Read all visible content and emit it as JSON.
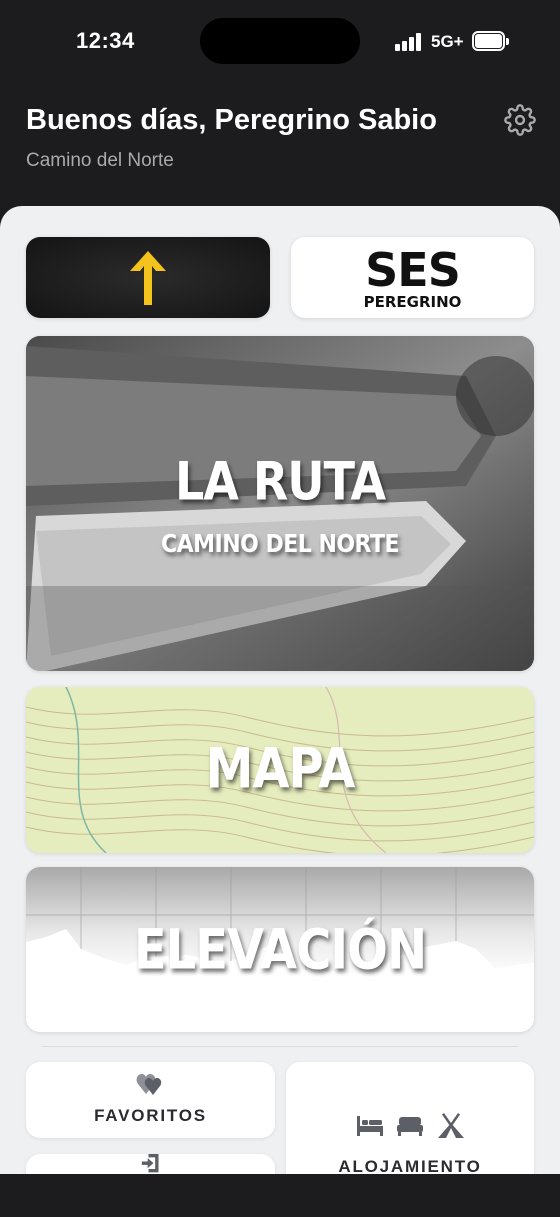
{
  "status_bar": {
    "time": "12:34",
    "network": "5G+"
  },
  "header": {
    "greeting": "Buenos días, Peregrino Sabio",
    "route": "Camino del Norte",
    "settings_icon": "gear-icon"
  },
  "cards": {
    "arrow": {
      "icon": "yellow-arrow-icon",
      "color": "#f5c31d"
    },
    "ses": {
      "title": "SES",
      "subtitle": "PEREGRINO"
    },
    "ruta": {
      "title": "LA RUTA",
      "subtitle": "CAMINO DEL NORTE"
    },
    "mapa": {
      "title": "MAPA"
    },
    "elevacion": {
      "title": "ELEVACIÓN"
    }
  },
  "tiles": {
    "favoritos": {
      "label": "FAVORITOS",
      "icon": "hearts-icon"
    },
    "login": {
      "label": "",
      "icon": "login-icon"
    },
    "alojamiento": {
      "label": "ALOJAMIENTO",
      "icons": [
        "bed-icon",
        "bed-icon",
        "tent-icon"
      ]
    }
  },
  "colors": {
    "header_bg": "#1c1c1e",
    "sheet_bg": "#eff0f2",
    "accent_yellow": "#f5c31d",
    "icon_gray": "#5d5f66"
  }
}
